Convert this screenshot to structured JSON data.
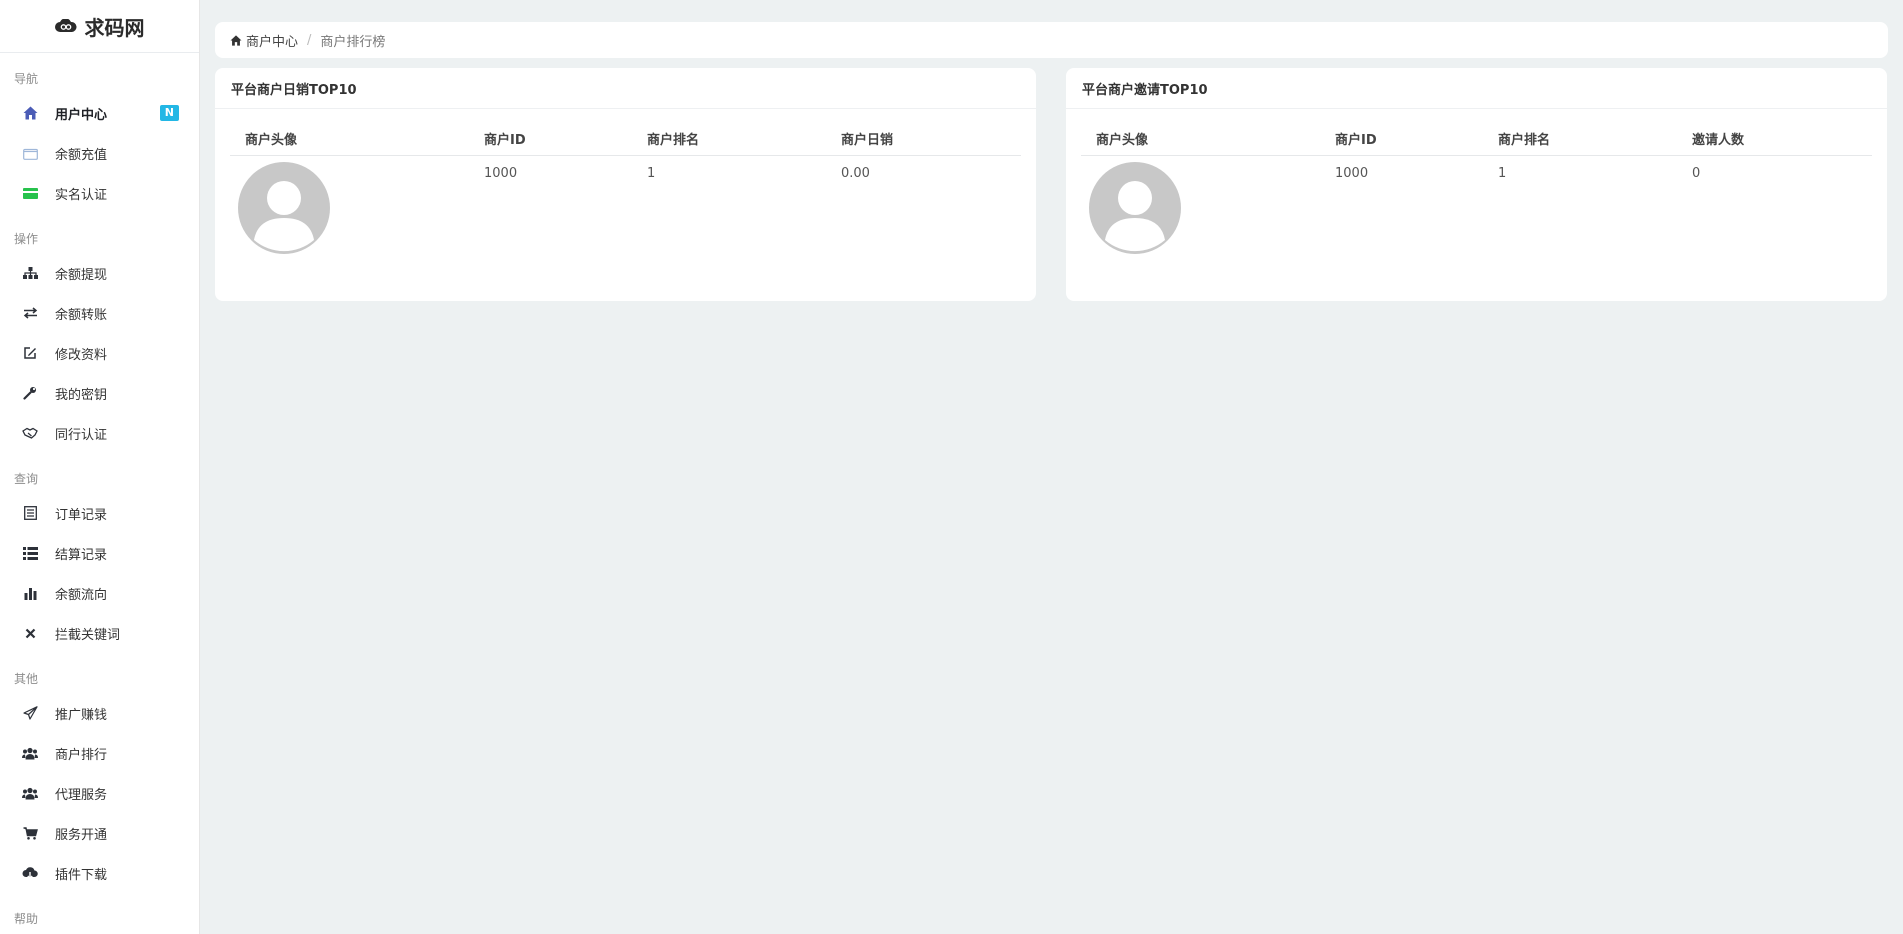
{
  "sidebar": {
    "brand": "求码网",
    "sections": {
      "nav": "导航",
      "ops": "操作",
      "query": "查询",
      "other": "其他",
      "help": "帮助"
    },
    "items": {
      "user_center": "用户中心",
      "user_center_badge": "N",
      "recharge": "余额充值",
      "realname": "实名认证",
      "withdraw": "余额提现",
      "transfer": "余额转账",
      "edit_profile": "修改资料",
      "my_key": "我的密钥",
      "peer_auth": "同行认证",
      "orders": "订单记录",
      "settlement": "结算记录",
      "balance_flow": "余额流向",
      "block_keywords": "拦截关键词",
      "promote": "推广赚钱",
      "ranking": "商户排行",
      "agent": "代理服务",
      "service_open": "服务开通",
      "plugin_download": "插件下载"
    }
  },
  "breadcrumb": {
    "home": "商户中心",
    "sep": "/",
    "current": "商户排行榜"
  },
  "panels": {
    "daily": {
      "title": "平台商户日销TOP10",
      "headers": [
        "商户头像",
        "商户ID",
        "商户排名",
        "商户日销"
      ],
      "row": {
        "id": "1000",
        "rank": "1",
        "value": "0.00"
      }
    },
    "invite": {
      "title": "平台商户邀请TOP10",
      "headers": [
        "商户头像",
        "商户ID",
        "商户排名",
        "邀请人数"
      ],
      "row": {
        "id": "1000",
        "rank": "1",
        "value": "0"
      }
    }
  },
  "colors": {
    "accent": "#4b5cb6",
    "badge": "#23b7e5",
    "background": "#edf1f2"
  }
}
